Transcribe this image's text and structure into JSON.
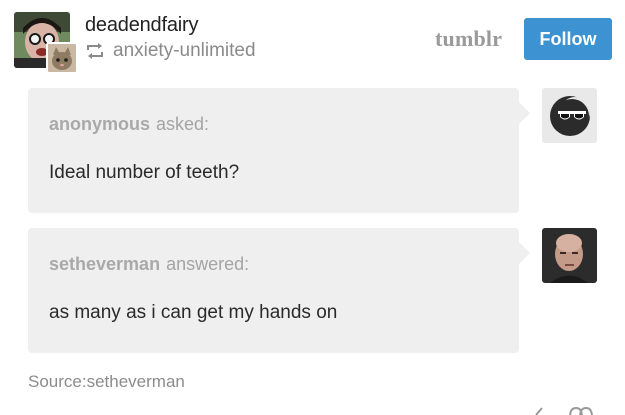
{
  "post": {
    "username": "deadendfairy",
    "reblogged_from": "anxiety-unlimited",
    "brand": "tumblr",
    "follow_label": "Follow",
    "icons": {
      "avatar": "user-avatar",
      "reblog_avatar": "cat-avatar",
      "reblog": "reblog-icon"
    }
  },
  "ask": {
    "asker_name": "anonymous",
    "verb": "asked:",
    "question": "Ideal number of teeth?",
    "avatar_icon": "anonymous-sunglasses-icon"
  },
  "answer": {
    "answerer_name": "setheverman",
    "verb": "answered:",
    "text": "as many as i can get my hands on",
    "avatar_icon": "user-avatar"
  },
  "source": {
    "text": "Source:setheverman"
  },
  "colors": {
    "follow_button": "#3d92d1",
    "bubble_bg": "#efefef",
    "muted_text": "#a4a4a4"
  }
}
